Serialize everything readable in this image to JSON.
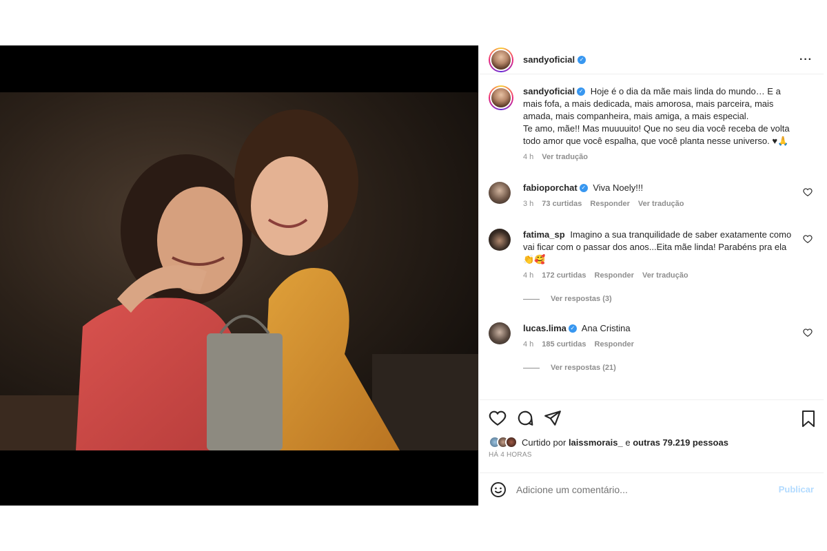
{
  "header": {
    "username": "sandyoficial",
    "more_label": "···"
  },
  "caption": {
    "username": "sandyoficial",
    "text_line1": "Hoje é o dia da mãe mais linda do mundo… E a mais fofa, a mais dedicada, mais amorosa, mais parceira, mais amada, mais companheira, mais amiga, a mais especial.",
    "text_line2": "Te amo, mãe!! Mas muuuuito! Que no seu dia você receba de volta todo amor que você espalha, que você planta nesse universo. ♥🙏",
    "time": "4 h",
    "translate": "Ver tradução"
  },
  "comments": [
    {
      "username": "fabioporchat",
      "text": "Viva Noely!!!",
      "time": "3 h",
      "likes": "73 curtidas",
      "reply": "Responder",
      "translate": "Ver tradução"
    },
    {
      "username": "fatima_sp",
      "text": "Imagino a sua tranquilidade de saber exatamente como vai ficar com o passar dos anos...Eita mãe linda! Parabéns pra ela 👏🥰",
      "time": "4 h",
      "likes": "172 curtidas",
      "reply": "Responder",
      "translate": "Ver tradução",
      "view_replies": "Ver respostas (3)"
    },
    {
      "username": "lucas.lima",
      "text": "Ana Cristina",
      "time": "4 h",
      "likes": "185 curtidas",
      "reply": "Responder",
      "view_replies": "Ver respostas (21)"
    }
  ],
  "likes": {
    "prefix": "Curtido por",
    "user": "laissmorais_",
    "middle": "e",
    "others": "outras 79.219 pessoas"
  },
  "timestamp": "HÁ 4 HORAS",
  "add_comment": {
    "placeholder": "Adicione um comentário...",
    "publish": "Publicar"
  },
  "colors": {
    "verified": "#3897f0",
    "publish_disabled": "#b3dbff",
    "muted_text": "#8e8e8e"
  }
}
